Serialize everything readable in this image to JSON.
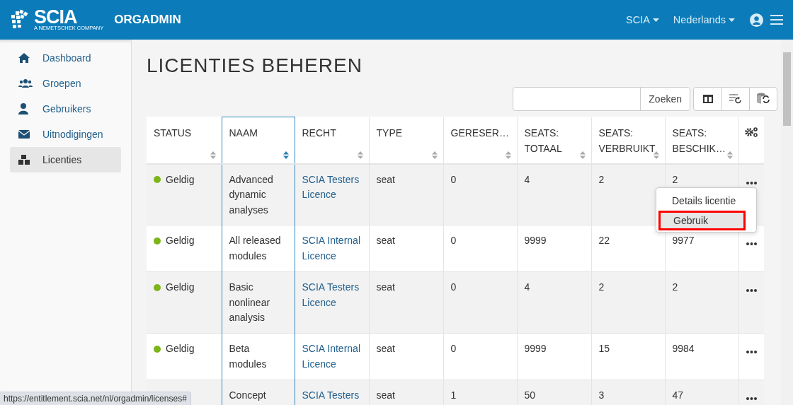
{
  "header": {
    "logo": "SCIA",
    "logo_tagline": "A NEMETSCHEK COMPANY",
    "app_name": "ORGADMIN",
    "menus": [
      {
        "label": "SCIA"
      },
      {
        "label": "Nederlands"
      }
    ]
  },
  "sidebar": {
    "items": [
      {
        "label": "Dashboard",
        "selected": false
      },
      {
        "label": "Groepen",
        "selected": false
      },
      {
        "label": "Gebruikers",
        "selected": false
      },
      {
        "label": "Uitnodigingen",
        "selected": false
      },
      {
        "label": "Licenties",
        "selected": true
      }
    ]
  },
  "page": {
    "title": "LICENTIES BEHEREN"
  },
  "search": {
    "button": "Zoeken"
  },
  "table": {
    "columns": [
      {
        "label": "STATUS",
        "sorted": false
      },
      {
        "label": "NAAM",
        "sorted": true
      },
      {
        "label": "RECHT",
        "sorted": false
      },
      {
        "label": "TYPE",
        "sorted": false
      },
      {
        "label": "GERESER…",
        "sorted": false
      },
      {
        "label": "SEATS: TOTAAL",
        "sorted": false
      },
      {
        "label": "SEATS: VERBRUIKT",
        "sorted": false
      },
      {
        "label": "SEATS: BESCHIK…",
        "sorted": false
      }
    ],
    "rows": [
      {
        "status": "Geldig",
        "color": "#7cb518",
        "name": "Advanced dynamic analyses",
        "right": "SCIA Testers Licence",
        "type": "seat",
        "reserved": "0",
        "total": "4",
        "used": "2",
        "available": "2"
      },
      {
        "status": "Geldig",
        "color": "#7cb518",
        "name": "All released modules",
        "right": "SCIA Internal Licence",
        "type": "seat",
        "reserved": "0",
        "total": "9999",
        "used": "22",
        "available": "9977"
      },
      {
        "status": "Geldig",
        "color": "#7cb518",
        "name": "Basic nonlinear analysis",
        "right": "SCIA Testers Licence",
        "type": "seat",
        "reserved": "0",
        "total": "4",
        "used": "2",
        "available": "2"
      },
      {
        "status": "Geldig",
        "color": "#7cb518",
        "name": "Beta modules",
        "right": "SCIA Internal Licence",
        "type": "seat",
        "reserved": "0",
        "total": "9999",
        "used": "15",
        "available": "9984"
      },
      {
        "name": "Concept",
        "right": "SCIA Testers",
        "type": "seat",
        "reserved": "1",
        "total": "50",
        "used": "3",
        "available": "47"
      }
    ]
  },
  "row_menu": {
    "items": [
      {
        "label": "Details licentie",
        "selected": false
      },
      {
        "label": "Gebruik",
        "selected": true
      }
    ]
  },
  "status_bar": {
    "url": "https://entitlement.scia.net/nl/orgadmin/licenses#"
  }
}
